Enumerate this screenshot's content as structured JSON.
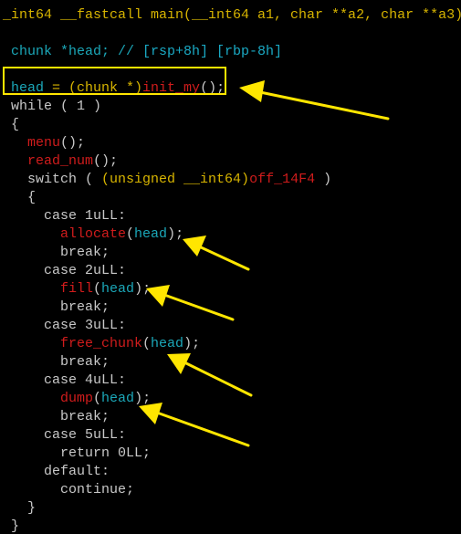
{
  "colors": {
    "default": "#c8c8c8",
    "keyword_type": "#d7b400",
    "variable": "#1ba7b8",
    "function": "#d01c1c",
    "comment": "#1aa9c4",
    "highlight": "#ffe600",
    "arrow": "#ffe600",
    "background": "#000000"
  },
  "highlighted_line": 4,
  "lines": [
    [
      {
        "t": "_int64 __fastcall main(__int64 a1, char **a2, char **a3)",
        "c": "keyword_type"
      }
    ],
    [
      {
        "t": "",
        "c": "default"
      }
    ],
    [
      {
        "t": " chunk *head; // ",
        "c": "variable"
      },
      {
        "t": "[rsp+8h] [rbp-8h]",
        "c": "comment"
      }
    ],
    [
      {
        "t": "",
        "c": "default"
      }
    ],
    [
      {
        "t": " head",
        "c": "variable"
      },
      {
        "t": " = (chunk *)",
        "c": "keyword_type"
      },
      {
        "t": "init_my",
        "c": "function"
      },
      {
        "t": "();",
        "c": "default"
      }
    ],
    [
      {
        "t": " while ( 1 )",
        "c": "default"
      }
    ],
    [
      {
        "t": " {",
        "c": "default"
      }
    ],
    [
      {
        "t": "   menu",
        "c": "function"
      },
      {
        "t": "();",
        "c": "default"
      }
    ],
    [
      {
        "t": "   read_num",
        "c": "function"
      },
      {
        "t": "();",
        "c": "default"
      }
    ],
    [
      {
        "t": "   switch ( ",
        "c": "default"
      },
      {
        "t": "(unsigned __int64)",
        "c": "keyword_type"
      },
      {
        "t": "off_14F4",
        "c": "function"
      },
      {
        "t": " )",
        "c": "default"
      }
    ],
    [
      {
        "t": "   {",
        "c": "default"
      }
    ],
    [
      {
        "t": "     case 1uLL:",
        "c": "default"
      }
    ],
    [
      {
        "t": "       allocate",
        "c": "function"
      },
      {
        "t": "(",
        "c": "default"
      },
      {
        "t": "head",
        "c": "variable"
      },
      {
        "t": ");",
        "c": "default"
      }
    ],
    [
      {
        "t": "       break;",
        "c": "default"
      }
    ],
    [
      {
        "t": "     case 2uLL:",
        "c": "default"
      }
    ],
    [
      {
        "t": "       fill",
        "c": "function"
      },
      {
        "t": "(",
        "c": "default"
      },
      {
        "t": "head",
        "c": "variable"
      },
      {
        "t": ");",
        "c": "default"
      }
    ],
    [
      {
        "t": "       break;",
        "c": "default"
      }
    ],
    [
      {
        "t": "     case 3uLL:",
        "c": "default"
      }
    ],
    [
      {
        "t": "       free_chunk",
        "c": "function"
      },
      {
        "t": "(",
        "c": "default"
      },
      {
        "t": "head",
        "c": "variable"
      },
      {
        "t": ");",
        "c": "default"
      }
    ],
    [
      {
        "t": "       break;",
        "c": "default"
      }
    ],
    [
      {
        "t": "     case 4uLL:",
        "c": "default"
      }
    ],
    [
      {
        "t": "       dump",
        "c": "function"
      },
      {
        "t": "(",
        "c": "default"
      },
      {
        "t": "head",
        "c": "variable"
      },
      {
        "t": ");",
        "c": "default"
      }
    ],
    [
      {
        "t": "       break;",
        "c": "default"
      }
    ],
    [
      {
        "t": "     case 5uLL:",
        "c": "default"
      }
    ],
    [
      {
        "t": "       return 0LL;",
        "c": "default"
      }
    ],
    [
      {
        "t": "     default:",
        "c": "default"
      }
    ],
    [
      {
        "t": "       continue;",
        "c": "default"
      }
    ],
    [
      {
        "t": "   }",
        "c": "default"
      }
    ],
    [
      {
        "t": " }",
        "c": "default"
      }
    ]
  ],
  "annotations": [
    "arrow-to-init-my",
    "arrow-to-allocate",
    "arrow-to-fill",
    "arrow-to-free-chunk",
    "arrow-to-dump"
  ]
}
